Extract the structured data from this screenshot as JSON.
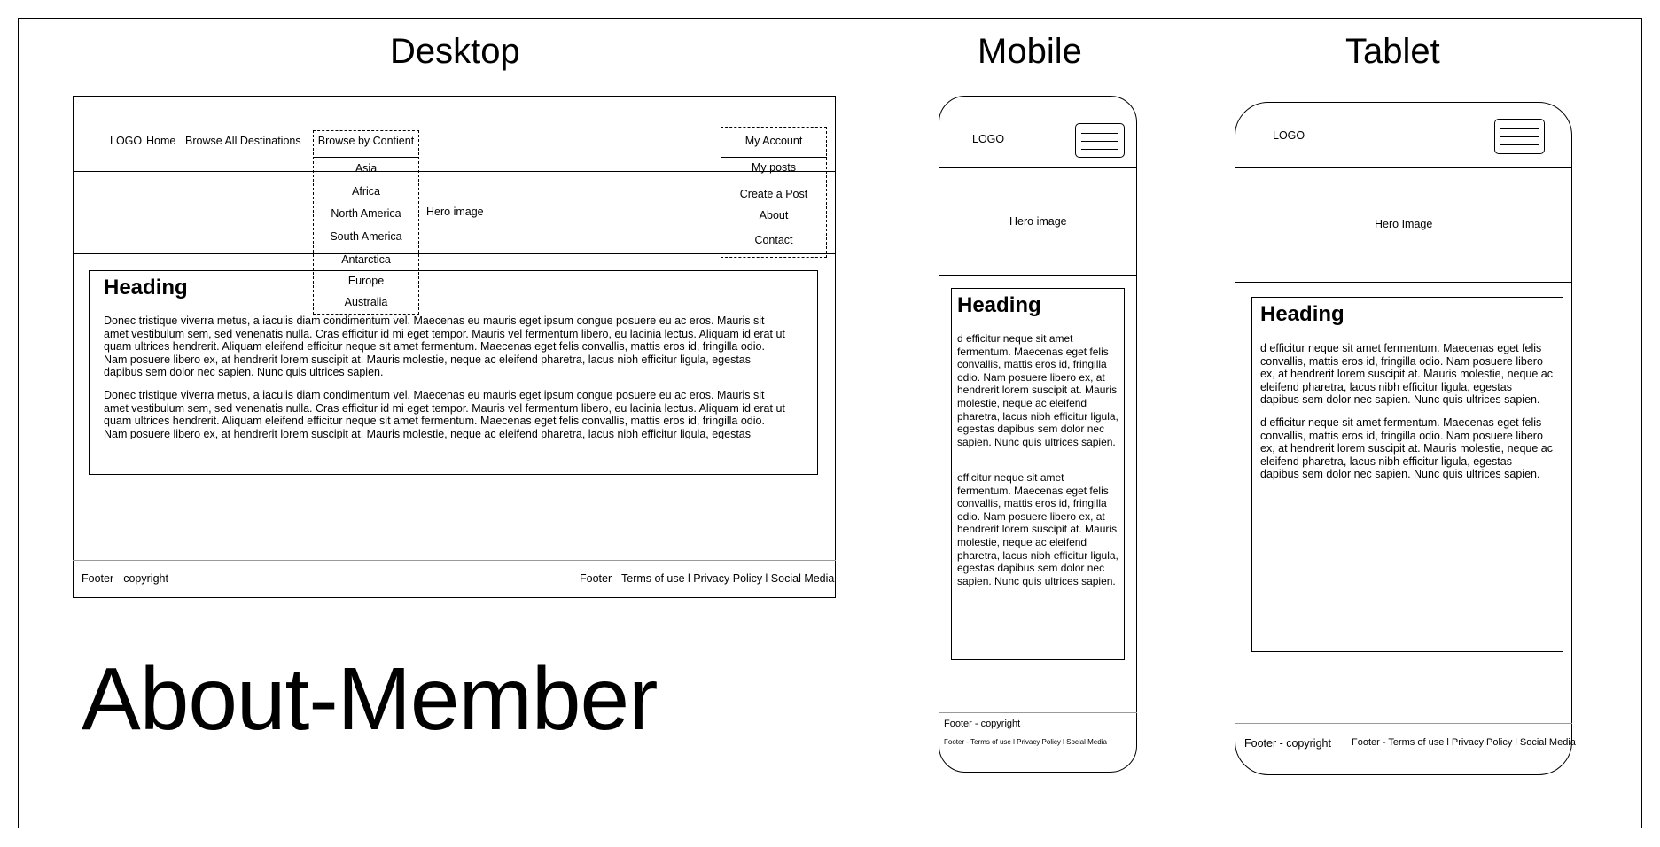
{
  "page_title": "About-Member",
  "views": {
    "desktop": {
      "label": "Desktop",
      "nav": {
        "logo": "LOGO",
        "home": "Home",
        "browse_all": "Browse All Destinations",
        "browse_by_continent": "Browse by Contient",
        "my_account": "My Account"
      },
      "continent_menu": [
        "Asia",
        "Africa",
        "North America",
        "South America",
        "Antarctica",
        "Europe",
        "Australia"
      ],
      "account_menu": [
        "My posts",
        "Create a Post",
        "About",
        "Contact"
      ],
      "hero": "Hero image",
      "heading": "Heading",
      "paragraph_1": "Donec tristique viverra metus, a iaculis diam condimentum vel. Maecenas eu mauris eget ipsum congue posuere eu ac eros. Mauris sit amet vestibulum sem, sed venenatis nulla. Cras efficitur id mi eget tempor. Mauris vel fermentum libero, eu lacinia lectus. Aliquam id erat ut quam ultrices hendrerit. Aliquam eleifend efficitur neque sit amet fermentum. Maecenas eget felis convallis, mattis eros id, fringilla odio. Nam posuere libero ex, at hendrerit lorem suscipit at. Mauris molestie, neque ac eleifend pharetra, lacus nibh efficitur ligula, egestas dapibus sem dolor nec sapien. Nunc quis ultrices sapien.",
      "paragraph_2": "Donec tristique viverra metus, a iaculis diam condimentum vel. Maecenas eu mauris eget ipsum congue posuere eu ac eros. Mauris sit amet vestibulum sem, sed venenatis nulla. Cras efficitur id mi eget tempor. Mauris vel fermentum libero, eu lacinia lectus. Aliquam id erat ut quam ultrices hendrerit. Aliquam eleifend efficitur neque sit amet fermentum. Maecenas eget felis convallis, mattis eros id, fringilla odio. Nam posuere libero ex, at hendrerit lorem suscipit at. Mauris molestie, neque ac eleifend pharetra, lacus nibh efficitur ligula, egestas dapibus sem dolor nec sapien. Nunc quis ultrices sapien.",
      "footer_left": "Footer - copyright",
      "footer_right": "Footer - Terms of use l Privacy Policy l Social Media"
    },
    "mobile": {
      "label": "Mobile",
      "logo": "LOGO",
      "menu_icon": "hamburger-menu-icon",
      "hero": "Hero image",
      "heading": "Heading",
      "paragraph_1": "d efficitur neque sit amet fermentum. Maecenas eget felis convallis, mattis eros id, fringilla odio. Nam posuere libero ex, at hendrerit lorem suscipit at. Mauris molestie, neque ac eleifend pharetra, lacus nibh efficitur ligula, egestas dapibus sem dolor nec sapien. Nunc quis ultrices sapien.",
      "paragraph_2": " efficitur neque sit amet fermentum. Maecenas eget felis convallis, mattis eros id, fringilla odio. Nam posuere libero ex, at hendrerit lorem suscipit at. Mauris molestie, neque ac eleifend pharetra, lacus nibh efficitur ligula, egestas dapibus sem dolor nec sapien. Nunc quis ultrices sapien.",
      "footer_copyright": "Footer - copyright",
      "footer_links": "Footer - Terms of use l Privacy Policy l Social Media"
    },
    "tablet": {
      "label": "Tablet",
      "logo": "LOGO",
      "menu_icon": "hamburger-menu-icon",
      "hero": "Hero Image",
      "heading": "Heading",
      "paragraph_1": "d efficitur neque sit amet fermentum. Maecenas eget felis convallis, mattis eros id, fringilla odio. Nam posuere libero ex, at hendrerit lorem suscipit at. Mauris molestie, neque ac eleifend pharetra, lacus nibh efficitur ligula, egestas dapibus sem dolor nec sapien. Nunc quis ultrices sapien.",
      "paragraph_2": "d efficitur neque sit amet fermentum. Maecenas eget felis convallis, mattis eros id, fringilla odio. Nam posuere libero ex, at hendrerit lorem suscipit at. Mauris molestie, neque ac eleifend pharetra, lacus nibh efficitur ligula, egestas dapibus sem dolor nec sapien. Nunc quis ultrices sapien.",
      "footer_copyright": "Footer - copyright",
      "footer_links": "Footer - Terms of use l Privacy Policy l Social Media"
    }
  }
}
